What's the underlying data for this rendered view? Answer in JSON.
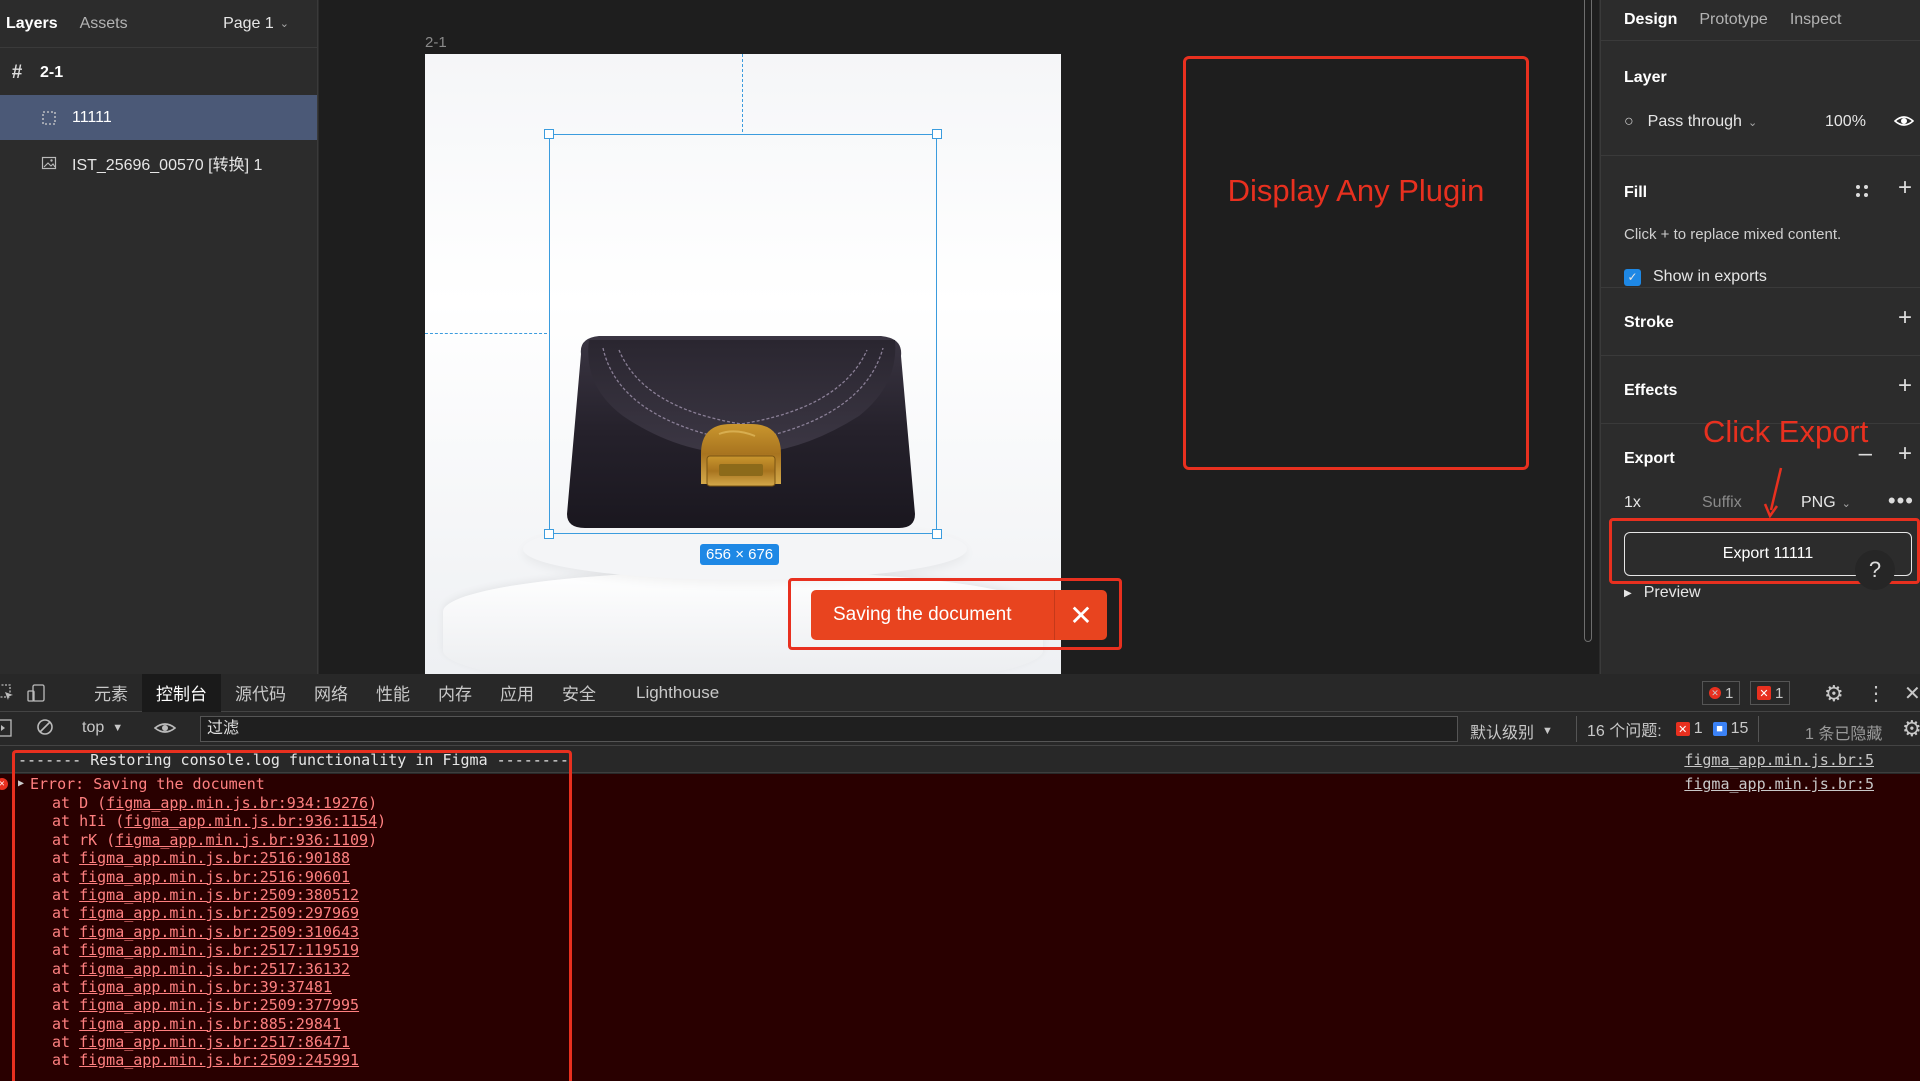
{
  "left_panel": {
    "tabs": [
      "Layers",
      "Assets"
    ],
    "page_selector": "Page 1",
    "layers": [
      {
        "name": "2-1"
      },
      {
        "name": "11111"
      },
      {
        "name": "IST_25696_00570 [转换] 1"
      }
    ]
  },
  "canvas": {
    "frame_label": "2-1",
    "selection_size": "656 × 676",
    "plugin_annotation": "Display Any Plugin",
    "toast_message": "Saving the document"
  },
  "right_panel": {
    "tabs": [
      "Design",
      "Prototype",
      "Inspect"
    ],
    "layer": {
      "title": "Layer",
      "blend_mode": "Pass through",
      "opacity": "100%"
    },
    "fill": {
      "title": "Fill",
      "hint": "Click + to replace mixed content.",
      "show_in_exports": "Show in exports"
    },
    "stroke": {
      "title": "Stroke"
    },
    "effects": {
      "title": "Effects"
    },
    "export": {
      "title": "Export",
      "scale": "1x",
      "suffix_placeholder": "Suffix",
      "format": "PNG",
      "button_label": "Export 11111",
      "annotation": "Click Export",
      "preview_label": "Preview"
    }
  },
  "devtools": {
    "tabs": [
      "元素",
      "控制台",
      "源代码",
      "网络",
      "性能",
      "内存",
      "应用",
      "安全",
      "Lighthouse"
    ],
    "active_tab": "控制台",
    "error_count": "1",
    "warning_count": "1",
    "context": "top",
    "filter_placeholder": "过滤",
    "level_select": "默认级别",
    "issues_label": "16 个问题:",
    "issues_errors": "1",
    "issues_info": "15",
    "hidden_label": "1 条已隐藏",
    "console": {
      "restore_line": "------- Restoring console.log functionality in Figma --------",
      "restore_source": "figma_app.min.js.br:5",
      "error_head": "Error: Saving the document",
      "error_source": "figma_app.min.js.br:5",
      "stack": [
        {
          "prefix": "at D (",
          "link": "figma_app.min.js.br:934:19276",
          "suffix": ")"
        },
        {
          "prefix": "at hIi (",
          "link": "figma_app.min.js.br:936:1154",
          "suffix": ")"
        },
        {
          "prefix": "at rK (",
          "link": "figma_app.min.js.br:936:1109",
          "suffix": ")"
        },
        {
          "prefix": "at ",
          "link": "figma_app.min.js.br:2516:90188",
          "suffix": ""
        },
        {
          "prefix": "at ",
          "link": "figma_app.min.js.br:2516:90601",
          "suffix": ""
        },
        {
          "prefix": "at ",
          "link": "figma_app.min.js.br:2509:380512",
          "suffix": ""
        },
        {
          "prefix": "at ",
          "link": "figma_app.min.js.br:2509:297969",
          "suffix": ""
        },
        {
          "prefix": "at ",
          "link": "figma_app.min.js.br:2509:310643",
          "suffix": ""
        },
        {
          "prefix": "at ",
          "link": "figma_app.min.js.br:2517:119519",
          "suffix": ""
        },
        {
          "prefix": "at ",
          "link": "figma_app.min.js.br:2517:36132",
          "suffix": ""
        },
        {
          "prefix": "at ",
          "link": "figma_app.min.js.br:39:37481",
          "suffix": ""
        },
        {
          "prefix": "at ",
          "link": "figma_app.min.js.br:2509:377995",
          "suffix": ""
        },
        {
          "prefix": "at ",
          "link": "figma_app.min.js.br:885:29841",
          "suffix": ""
        },
        {
          "prefix": "at ",
          "link": "figma_app.min.js.br:2517:86471",
          "suffix": ""
        },
        {
          "prefix": "at ",
          "link": "figma_app.min.js.br:2509:245991",
          "suffix": ""
        }
      ]
    }
  },
  "colors": {
    "annotation_red": "#e8301f",
    "selection_blue": "#3b9cde",
    "layer_selected": "#4b5977",
    "toast_bg": "#e8441f",
    "console_error_bg": "#290000"
  }
}
